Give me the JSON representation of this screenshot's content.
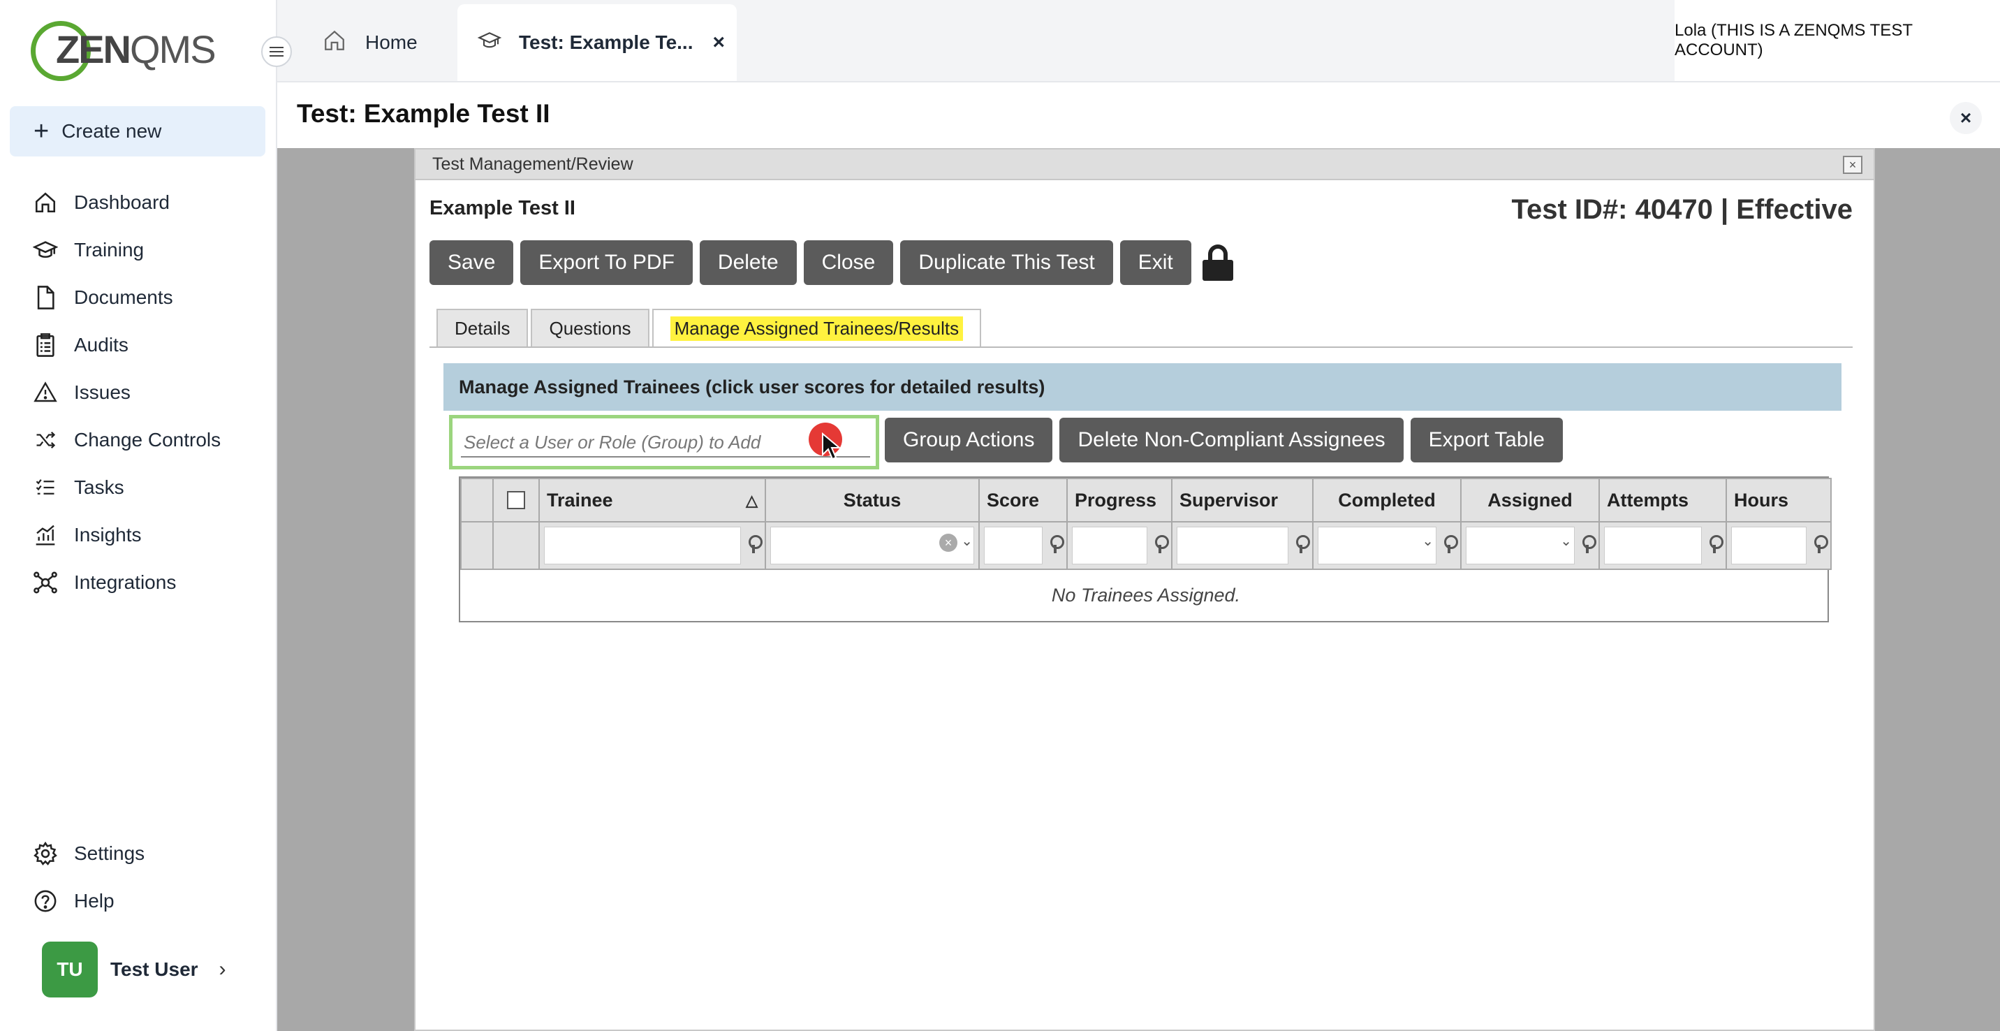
{
  "sidebar": {
    "logo": {
      "zen": "ZEN",
      "qms": "QMS"
    },
    "create_new": "Create new",
    "items": [
      {
        "label": "Dashboard",
        "icon": "home-icon"
      },
      {
        "label": "Training",
        "icon": "graduation-cap-icon"
      },
      {
        "label": "Documents",
        "icon": "document-icon"
      },
      {
        "label": "Audits",
        "icon": "clipboard-icon"
      },
      {
        "label": "Issues",
        "icon": "warning-icon"
      },
      {
        "label": "Change Controls",
        "icon": "shuffle-icon"
      },
      {
        "label": "Tasks",
        "icon": "checklist-icon"
      },
      {
        "label": "Insights",
        "icon": "chart-icon"
      },
      {
        "label": "Integrations",
        "icon": "network-icon"
      }
    ],
    "bottom_items": [
      {
        "label": "Settings",
        "icon": "gear-icon"
      },
      {
        "label": "Help",
        "icon": "help-icon"
      }
    ],
    "user": {
      "initials": "TU",
      "name": "Test User"
    }
  },
  "topbar": {
    "tabs": [
      {
        "label": "Home",
        "icon": "home-icon"
      },
      {
        "label": "Test: Example Te...",
        "icon": "graduation-cap-icon"
      }
    ],
    "close_glyph": "×",
    "account": "Lola (THIS IS A ZENQMS TEST ACCOUNT)"
  },
  "page": {
    "title": "Test: Example Test II",
    "close_glyph": "×"
  },
  "dialog": {
    "title": "Test Management/Review",
    "close_glyph": "×",
    "test_name": "Example Test II",
    "test_id": "Test ID#: 40470 | Effective",
    "buttons": {
      "save": "Save",
      "export_pdf": "Export To PDF",
      "delete": "Delete",
      "close": "Close",
      "duplicate": "Duplicate This Test",
      "exit": "Exit"
    },
    "tabs": {
      "details": "Details",
      "questions": "Questions",
      "manage": "Manage Assigned Trainees/Results"
    },
    "section_header": "Manage Assigned Trainees (click user scores for detailed results)",
    "add_placeholder": "Select a User or Role (Group) to Add",
    "actions": {
      "group": "Group Actions",
      "delete_noncompliant": "Delete Non-Compliant Assignees",
      "export_table": "Export Table"
    },
    "table": {
      "columns": [
        "Trainee",
        "Status",
        "Score",
        "Progress",
        "Supervisor",
        "Completed",
        "Assigned",
        "Attempts",
        "Hours"
      ],
      "sort_glyph": "△",
      "empty_message": "No Trainees Assigned."
    }
  },
  "colors": {
    "accent": "#5aa832",
    "button": "#5b5b5b",
    "section_header": "#b5cedc",
    "highlight": "#fff23f",
    "overlay": "#a8a8a8"
  }
}
